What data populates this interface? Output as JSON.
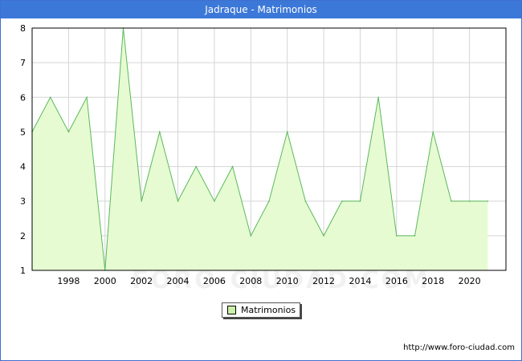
{
  "header": {
    "title": "Jadraque - Matrimonios"
  },
  "footer": {
    "url": "http://www.foro-ciudad.com"
  },
  "watermark": {
    "text": "FORO-CIUDAD.COM"
  },
  "colors": {
    "title_bar": "#3c78d8",
    "area_fill": "#e6fbd2",
    "area_line": "#5cb85c",
    "grid": "#d5d5d5",
    "legend_swatch": "#ccf0aa"
  },
  "chart_data": {
    "type": "area",
    "title": "Jadraque - Matrimonios",
    "xlabel": "",
    "ylabel": "",
    "x": [
      1996,
      1997,
      1998,
      1999,
      2000,
      2001,
      2002,
      2003,
      2004,
      2005,
      2006,
      2007,
      2008,
      2009,
      2010,
      2011,
      2012,
      2013,
      2014,
      2015,
      2016,
      2017,
      2018,
      2019,
      2020,
      2021
    ],
    "series": [
      {
        "name": "Matrimonios",
        "values": [
          5,
          6,
          5,
          6,
          1,
          8,
          3,
          5,
          3,
          4,
          3,
          4,
          2,
          3,
          5,
          3,
          2,
          3,
          3,
          6,
          2,
          2,
          5,
          3,
          3,
          3
        ]
      }
    ],
    "xlim": [
      1996,
      2022
    ],
    "ylim": [
      1,
      8
    ],
    "xticks": [
      "1998",
      "2000",
      "2002",
      "2004",
      "2006",
      "2008",
      "2010",
      "2012",
      "2014",
      "2016",
      "2018",
      "2020"
    ],
    "yticks": [
      "1",
      "2",
      "3",
      "4",
      "5",
      "6",
      "7",
      "8"
    ],
    "grid": true,
    "legend": {
      "position": "bottom-center",
      "entries": [
        "Matrimonios"
      ]
    }
  }
}
